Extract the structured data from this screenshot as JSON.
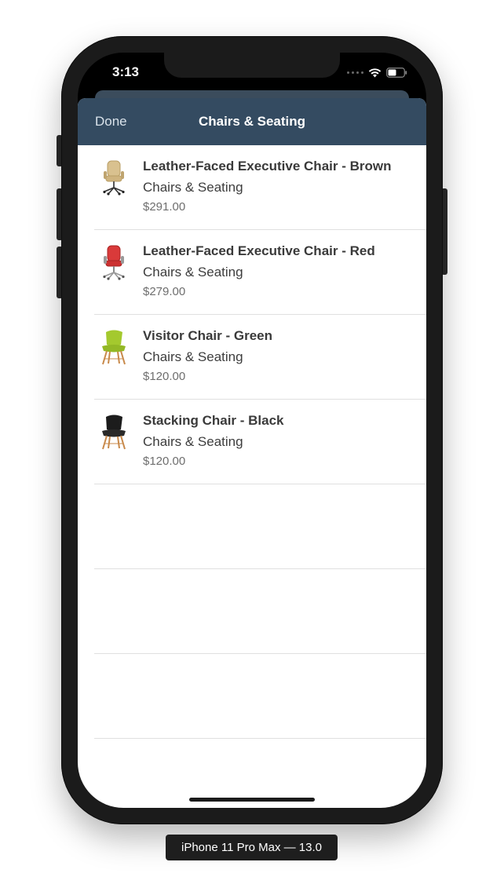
{
  "status_bar": {
    "time": "3:13"
  },
  "nav": {
    "done_label": "Done",
    "title": "Chairs & Seating"
  },
  "products": [
    {
      "name": "Leather-Faced Executive Chair - Brown",
      "category": "Chairs & Seating",
      "price": "$291.00",
      "icon": "executive-chair-icon",
      "color": "#d9c18f"
    },
    {
      "name": "Leather-Faced Executive Chair - Red",
      "category": "Chairs & Seating",
      "price": "$279.00",
      "icon": "executive-chair-icon",
      "color": "#d93a3a"
    },
    {
      "name": "Visitor Chair - Green",
      "category": "Chairs & Seating",
      "price": "$120.00",
      "icon": "visitor-chair-icon",
      "color": "#a4c92e"
    },
    {
      "name": "Stacking Chair - Black",
      "category": "Chairs & Seating",
      "price": "$120.00",
      "icon": "stacking-chair-icon",
      "color": "#1c1c1c"
    }
  ],
  "device_label": "iPhone 11 Pro Max — 13.0"
}
